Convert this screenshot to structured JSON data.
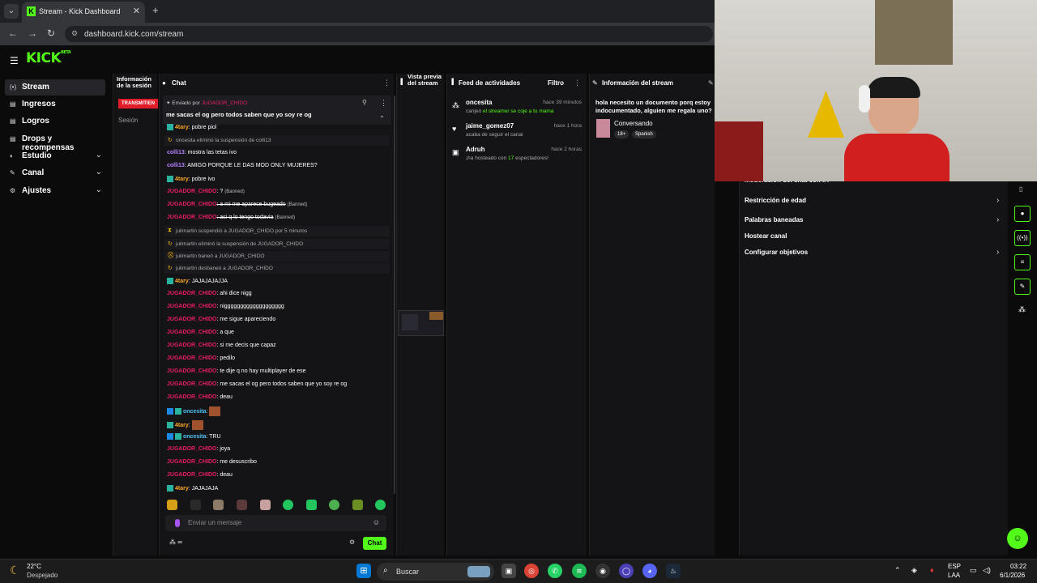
{
  "browser": {
    "tab_title": "Stream - Kick Dashboard",
    "tab_icon_letter": "K",
    "url": "dashboard.kick.com/stream"
  },
  "kick": {
    "logo": "KICK",
    "logo_badge": "BETA",
    "nav": [
      {
        "label": "Stream",
        "icon": "broadcast-icon",
        "active": true
      },
      {
        "label": "Ingresos",
        "icon": "money-icon"
      },
      {
        "label": "Logros",
        "icon": "trophy-icon"
      },
      {
        "label": "Drops y recompensas",
        "icon": "gift-icon"
      },
      {
        "label": "Estudio",
        "icon": "studio-icon",
        "chevron": true
      },
      {
        "label": "Canal",
        "icon": "channel-icon",
        "chevron": true
      },
      {
        "label": "Ajustes",
        "icon": "gear-icon",
        "chevron": true
      }
    ]
  },
  "info_panel": {
    "title": "Información de la sesión",
    "badge": "TRANSMITIEN",
    "session_label": "Sesión"
  },
  "chat": {
    "title": "Chat",
    "pinned_by_label": "Enviado por",
    "pinned_user": "JUGADOR_CHIDO",
    "pinned_text": "me sacas el og pero todos saben que yo soy re og",
    "input_placeholder": "Enviar un mensaje",
    "send_label": "Chat",
    "messages": [
      {
        "type": "msg",
        "user": "4tary",
        "color": "u4",
        "badge": true,
        "text": ": pobre piol"
      },
      {
        "type": "sys",
        "icon": "unban",
        "text": "oncesita eliminó la suspensión de colli13"
      },
      {
        "type": "msg",
        "user": "colli13",
        "color": "u3",
        "text": ": mostra las tetas ivo"
      },
      {
        "type": "msg",
        "user": "colli13",
        "color": "u3",
        "text": ": AMIGO PORQUE LE DAS MOD ONLY MUJERES?"
      },
      {
        "type": "msg",
        "user": "4tary",
        "color": "u4",
        "badge": true,
        "text": ": pobre ivo"
      },
      {
        "type": "msg",
        "user": "JUGADOR_CHIDO",
        "color": "u1",
        "text": ": ?",
        "banned": "(Banned)"
      },
      {
        "type": "msg",
        "user": "JUGADOR_CHIDO",
        "color": "u1",
        "text": ": a mi me aparece bugeado",
        "strike": true,
        "banned": "(Banned)"
      },
      {
        "type": "msg",
        "user": "JUGADOR_CHIDO",
        "color": "u1",
        "text": ": asi q lo tengo todavia",
        "strike": true,
        "banned": "(Banned)"
      },
      {
        "type": "sys",
        "icon": "timeout",
        "text": "julimartin suspendió a JUGADOR_CHIDO por 5 minutos"
      },
      {
        "type": "sys",
        "icon": "unban",
        "text": "julimartin eliminó la suspensión de JUGADOR_CHIDO"
      },
      {
        "type": "sys",
        "icon": "ban",
        "text": "julimartin baneó a JUGADOR_CHIDO"
      },
      {
        "type": "sys",
        "icon": "unban",
        "text": "julimartin desbaneó a JUGADOR_CHIDO"
      },
      {
        "type": "msg",
        "user": "4tary",
        "color": "u4",
        "badge": true,
        "text": ": JAJAJAJAJJA"
      },
      {
        "type": "msg",
        "user": "JUGADOR_CHIDO",
        "color": "u1",
        "text": ": ahi dice nigg"
      },
      {
        "type": "msg",
        "user": "JUGADOR_CHIDO",
        "color": "u1",
        "text": ": niggggggggggggggggggg"
      },
      {
        "type": "msg",
        "user": "JUGADOR_CHIDO",
        "color": "u1",
        "text": ": me sigue apareciendo"
      },
      {
        "type": "msg",
        "user": "JUGADOR_CHIDO",
        "color": "u1",
        "text": ": a que"
      },
      {
        "type": "msg",
        "user": "JUGADOR_CHIDO",
        "color": "u1",
        "text": ": si me decis que capaz"
      },
      {
        "type": "msg",
        "user": "JUGADOR_CHIDO",
        "color": "u1",
        "text": ": pedilo"
      },
      {
        "type": "msg",
        "user": "JUGADOR_CHIDO",
        "color": "u1",
        "text": ": te dije q no hay multiplayer de ese"
      },
      {
        "type": "msg",
        "user": "JUGADOR_CHIDO",
        "color": "u1",
        "text": ": me sacas el og pero todos saben que yo soy re og"
      },
      {
        "type": "msg",
        "user": "JUGADOR_CHIDO",
        "color": "u1",
        "text": ": deau"
      },
      {
        "type": "msg",
        "user": "oncesita",
        "color": "u5",
        "badge": true,
        "badge2": true,
        "text": ":",
        "emote": true
      },
      {
        "type": "msg",
        "user": "4tary",
        "color": "u4",
        "badge": true,
        "text": ":",
        "emote": true
      },
      {
        "type": "msg",
        "user": "oncesita",
        "color": "u5",
        "badge": true,
        "badge2": true,
        "text": ": TRU"
      },
      {
        "type": "msg",
        "user": "JUGADOR_CHIDO",
        "color": "u1",
        "text": ": joya"
      },
      {
        "type": "msg",
        "user": "JUGADOR_CHIDO",
        "color": "u1",
        "text": ": me desuscribo"
      },
      {
        "type": "msg",
        "user": "JUGADOR_CHIDO",
        "color": "u1",
        "text": ": deau"
      },
      {
        "type": "msg",
        "user": "4tary",
        "color": "u4",
        "badge": true,
        "text": ": JAJAJAJA"
      }
    ]
  },
  "preview": {
    "title": "Vista previa del stream"
  },
  "feed": {
    "title": "Feed de actividades",
    "filter_label": "Filtro",
    "items": [
      {
        "name": "oncesita",
        "time": "hace 39 minutos",
        "pre": "canjeó",
        "hl": "el streamer se coje a tu mama",
        "post": "",
        "icon": "reward-icon"
      },
      {
        "name": "jaime_gomez07",
        "time": "hace 1 hora",
        "pre": "acaba de seguir el canal",
        "hl": "",
        "post": "",
        "icon": "heart-icon"
      },
      {
        "name": "Adruh",
        "time": "hace 2 horas",
        "pre": "¡ha hosteado con",
        "hl": "17",
        "post": "espectadores!",
        "icon": "host-icon"
      }
    ]
  },
  "stream_info": {
    "title": "Información del stream",
    "stream_title": "hola necesito un documento porq estoy indocumentado, alguien me regala uno?",
    "category": "Conversando",
    "tags": [
      "18+",
      "Spanish"
    ]
  },
  "mod_panel": {
    "items": [
      {
        "label": "Moderación del chat con IA",
        "chevron": false
      },
      {
        "label": "Restricción de edad",
        "chevron": true
      },
      {
        "label": "Palabras baneadas",
        "chevron": true
      },
      {
        "label": "Hostear canal",
        "chevron": false
      },
      {
        "label": "Configurar objetivos",
        "chevron": true
      }
    ]
  },
  "taskbar": {
    "weather_temp": "22°C",
    "weather_desc": "Despejado",
    "search_label": "Buscar",
    "lang_top": "ESP",
    "lang_bottom": "LAA",
    "time": "03:22",
    "date": "6/1/2026"
  },
  "colors": {
    "accent": "#53fc18",
    "danger": "#e91e63"
  }
}
